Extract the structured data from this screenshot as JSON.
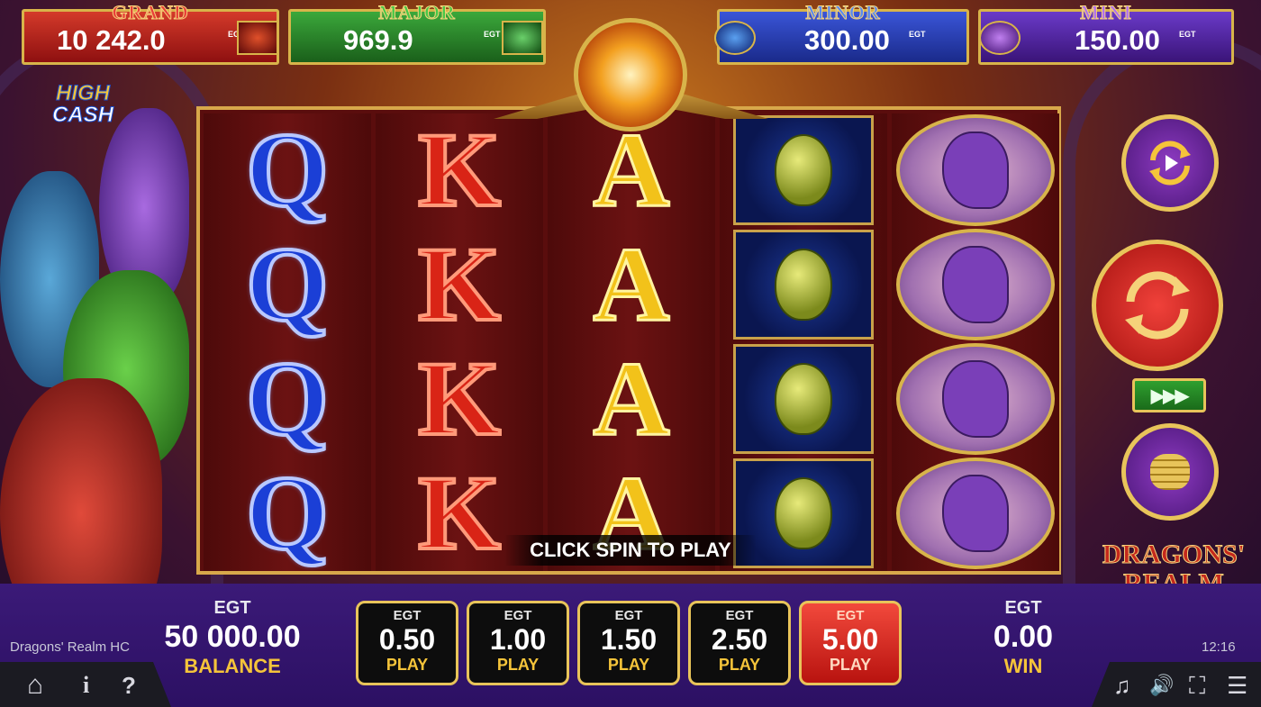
{
  "jackpots": {
    "grand": {
      "title": "GRAND",
      "value": "10 242.0",
      "currency": "EGT",
      "color": "#c42020"
    },
    "major": {
      "title": "MAJOR",
      "value": "969.9",
      "currency": "EGT",
      "color": "#2a8a2a"
    },
    "minor": {
      "title": "MINOR",
      "value": "300.00",
      "currency": "EGT",
      "color": "#2a3fb8"
    },
    "mini": {
      "title": "MINI",
      "value": "150.00",
      "currency": "EGT",
      "color": "#5a2aa8"
    }
  },
  "logos": {
    "high_cash_line1": "HIGH",
    "high_cash_line2": "CASH",
    "dragons_realm_line1": "DRAGONS'",
    "dragons_realm_line2": "REALM"
  },
  "reels": [
    [
      "Q",
      "Q",
      "Q",
      "Q"
    ],
    [
      "K",
      "K",
      "K",
      "K"
    ],
    [
      "A",
      "A",
      "A",
      "A"
    ],
    [
      "egg",
      "egg",
      "egg",
      "egg"
    ],
    [
      "dragon",
      "dragon",
      "dragon",
      "dragon"
    ]
  ],
  "message": "CLICK SPIN TO PLAY",
  "balance": {
    "currency": "EGT",
    "amount": "50 000.00",
    "label": "BALANCE"
  },
  "win": {
    "currency": "EGT",
    "amount": "0.00",
    "label": "WIN"
  },
  "bets": [
    {
      "currency": "EGT",
      "value": "0.50",
      "label": "PLAY",
      "selected": false
    },
    {
      "currency": "EGT",
      "value": "1.00",
      "label": "PLAY",
      "selected": false
    },
    {
      "currency": "EGT",
      "value": "1.50",
      "label": "PLAY",
      "selected": false
    },
    {
      "currency": "EGT",
      "value": "2.50",
      "label": "PLAY",
      "selected": false
    },
    {
      "currency": "EGT",
      "value": "5.00",
      "label": "PLAY",
      "selected": true
    }
  ],
  "turbo_label": "▶▶▶",
  "game_name": "Dragons' Realm HC",
  "clock": "12:16",
  "nav": {
    "home": "⌂",
    "info": "i",
    "help": "?",
    "music": "♫",
    "sound": "🔊",
    "fullscreen": "⛶",
    "menu": "☰"
  }
}
